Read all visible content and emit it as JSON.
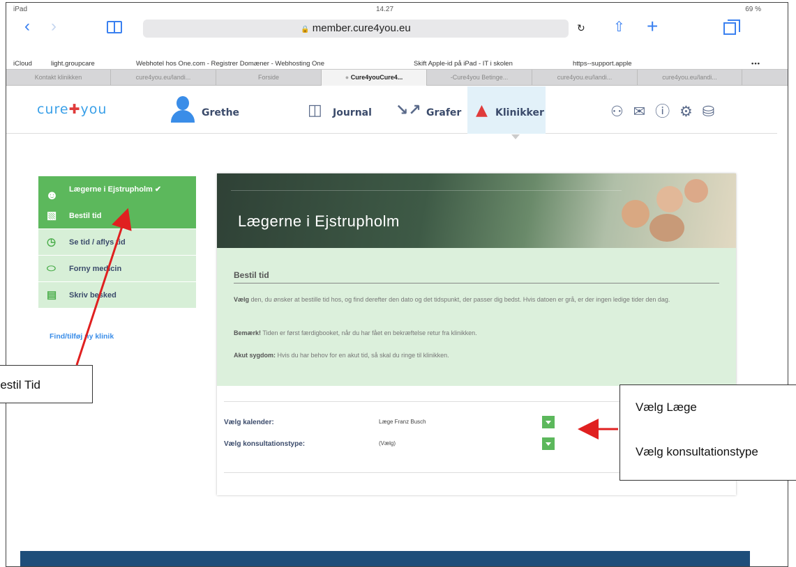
{
  "statusbar": {
    "device": "iPad",
    "time": "14.27",
    "battery": "69 %"
  },
  "browser": {
    "url": "member.cure4you.eu",
    "favorites": [
      "iCloud",
      "light.groupcare",
      "Webhotel hos One.com - Registrer Domæner - Webhosting One",
      "Skift Apple-id på iPad - IT i skolen",
      "https--support.apple",
      "•••"
    ],
    "tabs": [
      "Kontakt klinikken",
      "cure4you.eu/landi...",
      "Forside",
      "Cure4youCure4...",
      "-Cure4you Betinge...",
      "cure4you.eu/landi...",
      "cure4you.eu/landi..."
    ]
  },
  "header": {
    "logo_left": "cure",
    "logo_cross": "✚",
    "logo_right": "you",
    "user_name": "Grethe",
    "nav": {
      "journal": "Journal",
      "grafer": "Grafer",
      "klinikker": "Klinikker"
    }
  },
  "sidebar": {
    "clinic": "Lægerne i Ejstrupholm",
    "items": [
      "Bestil tid",
      "Se tid / aflys tid",
      "Forny medicin",
      "Skriv besked"
    ],
    "link": "Find/tilføj ny klinik"
  },
  "main": {
    "banner_title": "Lægerne i Ejstrupholm",
    "section_title": "Bestil tid",
    "p1_bold": "Vælg",
    "p1_text": " den, du ønsker at bestille tid hos, og find derefter den dato og det tidspunkt, der passer dig bedst. Hvis datoen er grå, er der ingen ledige tider den dag.",
    "p2_bold": "Bemærk!",
    "p2_text": " Tiden er først færdigbooket, når du har fået en bekræftelse retur fra klinikken.",
    "p3_bold": "Akut sygdom:",
    "p3_text": " Hvis du har behov for en akut tid, så skal du ringe til klinikken.",
    "form": {
      "calendar_label": "Vælg kalender:",
      "calendar_value": "Læge Franz Busch",
      "type_label": "Vælg konsultationstype:",
      "type_value": "(Vælg)"
    }
  },
  "annotations": {
    "left": "Bestil Tid",
    "right_line1": "Vælg Læge",
    "right_line2": "Vælg konsultationstype"
  },
  "colors": {
    "green": "#5cb85c",
    "light_green": "#dcf0dc",
    "blue": "#3a8de8",
    "annotation_arrow": "#e02020"
  }
}
